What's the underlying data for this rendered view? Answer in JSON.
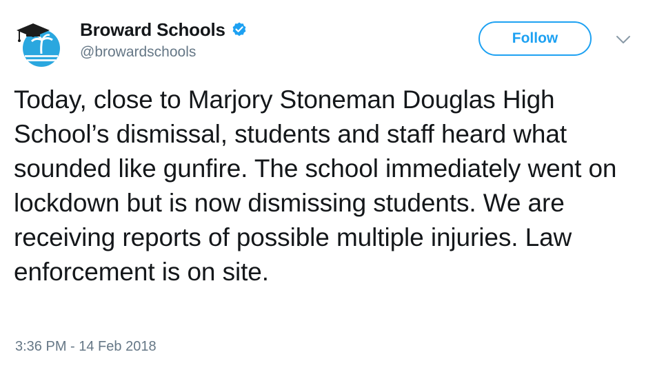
{
  "author": {
    "display_name": "Broward Schools",
    "handle": "@browardschools",
    "verified": true,
    "avatar_icon": "broward-schools-logo"
  },
  "actions": {
    "follow_label": "Follow",
    "more_icon": "chevron-down-icon"
  },
  "tweet": {
    "text": "Today, close to Marjory Stoneman Douglas High School’s dismissal, students and staff heard what sounded like gunfire. The school immediately went on lockdown but is now dismissing students. We are receiving reports of possible multiple injuries. Law enforcement is on site.",
    "timestamp": "3:36 PM - 14 Feb 2018"
  },
  "colors": {
    "accent": "#1da1f2",
    "text": "#14171a",
    "muted": "#657786"
  }
}
